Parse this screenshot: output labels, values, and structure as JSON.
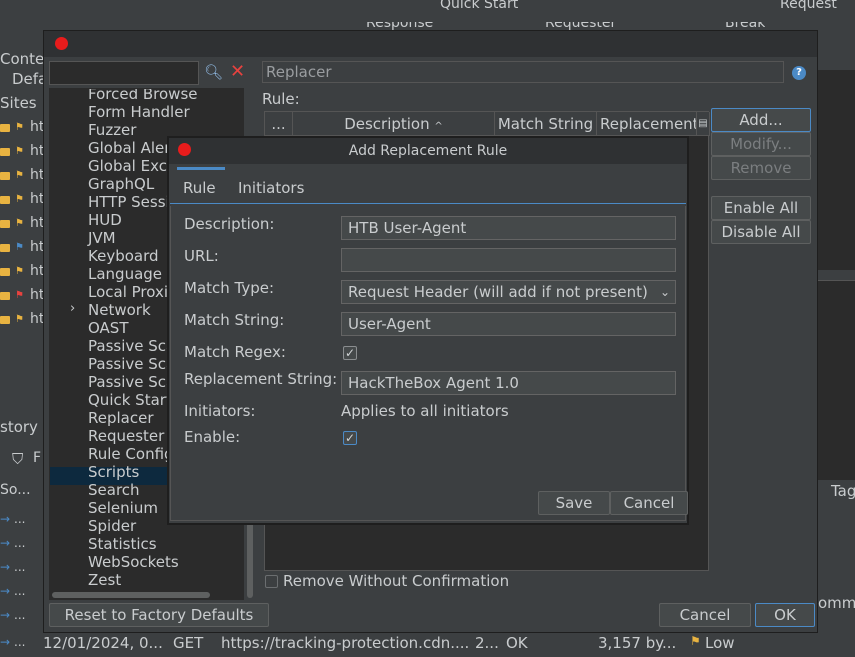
{
  "background": {
    "toolbar": {
      "quick_start": "Quick Start",
      "request": "Request",
      "response": "Response",
      "requester": "Requester",
      "break": "Break"
    },
    "left_panel": {
      "context": "Contex",
      "default": "Defa",
      "sites": "Sites",
      "site_prefix": "ht",
      "history": "story",
      "filter_label": "F",
      "source_col": "So...",
      "dots": "..."
    },
    "right_panel": {
      "tag_col": "Tag",
      "comment": "omme"
    },
    "history_row": {
      "date": "12/01/2024, 0...",
      "method": "GET",
      "url": "https://tracking-protection.cdn....",
      "code": "2...",
      "reason": "OK",
      "size": "3,157 by...",
      "risk": "Low"
    }
  },
  "options_dialog": {
    "search_value": "",
    "tree": {
      "items": [
        "Forced Browse",
        "Form Handler",
        "Fuzzer",
        "Global Alert",
        "Global Excl",
        "GraphQL",
        "HTTP Sessi",
        "HUD",
        "JVM",
        "Keyboard",
        "Language",
        "Local Proxi",
        "Network",
        "OAST",
        "Passive Sca",
        "Passive Sca",
        "Passive Sca",
        "Quick Start",
        "Replacer",
        "Requester",
        "Rule Config",
        "Scripts",
        "Search",
        "Selenium",
        "Spider",
        "Statistics",
        "WebSockets",
        "Zest"
      ]
    },
    "replacer": {
      "header": "Replacer",
      "rule_label": "Rule:",
      "columns": [
        "...",
        "Description",
        "Match String",
        "Replacement"
      ],
      "buttons": {
        "add": "Add...",
        "modify": "Modify...",
        "remove": "Remove",
        "enable_all": "Enable All",
        "disable_all": "Disable All"
      },
      "remove_without_confirmation": "Remove Without Confirmation"
    },
    "footer": {
      "reset": "Reset to Factory Defaults",
      "cancel": "Cancel",
      "ok": "OK"
    }
  },
  "rule_dialog": {
    "title": "Add Replacement Rule",
    "tabs": [
      "Rule",
      "Initiators"
    ],
    "labels": {
      "description": "Description:",
      "url": "URL:",
      "match_type": "Match Type:",
      "match_string": "Match String:",
      "match_regex": "Match Regex:",
      "replacement_string": "Replacement String:",
      "initiators": "Initiators:",
      "enable": "Enable:"
    },
    "values": {
      "description": "HTB User-Agent",
      "url": "",
      "match_type": "Request Header (will add if not present)",
      "match_string": "User-Agent",
      "match_regex": true,
      "replacement_string": "HackTheBox Agent 1.0",
      "initiators": "Applies to all initiators",
      "enable": true
    },
    "buttons": {
      "save": "Save",
      "cancel": "Cancel"
    }
  },
  "colors": {
    "accent": "#4b8ac6",
    "close_red": "#e81c1c",
    "selection": "#0d293e"
  }
}
